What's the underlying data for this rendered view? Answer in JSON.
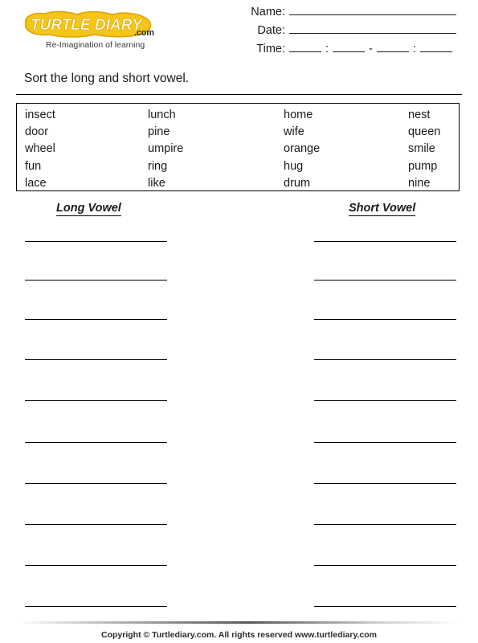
{
  "brand": {
    "logo_text": "Turtle Diary",
    "logo_word_1": "TURTLE",
    "logo_word_2": "DIARY",
    "dotcom": ".com",
    "tagline": "Re-Imagination of learning",
    "logo_fill": "#f5c518",
    "logo_stroke": "#e8a000",
    "logo_text_color": "#ffffff"
  },
  "header": {
    "name_label": "Name:",
    "date_label": "Date:",
    "time_label": "Time:",
    "name_value": "",
    "date_value": "",
    "time_sep_1": ":",
    "time_sep_2": "-",
    "time_sep_3": ":"
  },
  "instruction": {
    "text": "Sort the long and short vowel."
  },
  "word_bank": {
    "rows": [
      [
        "insect",
        "lunch",
        "home",
        "nest"
      ],
      [
        "door",
        "pine",
        "wife",
        "queen"
      ],
      [
        "wheel",
        "umpire",
        "orange",
        "smile"
      ],
      [
        "fun",
        "ring",
        "hug",
        "pump"
      ],
      [
        "lace",
        "like",
        "drum",
        "nine"
      ]
    ],
    "words_flat": [
      "insect",
      "lunch",
      "home",
      "nest",
      "door",
      "pine",
      "wife",
      "queen",
      "wheel",
      "umpire",
      "orange",
      "smile",
      "fun",
      "ring",
      "hug",
      "pump",
      "lace",
      "like",
      "drum",
      "nine"
    ]
  },
  "answers": {
    "long_vowel_heading": "Long Vowel",
    "short_vowel_heading": "Short Vowel",
    "line_count_per_column": 10,
    "long_vowel_entries": [
      "",
      "",
      "",
      "",
      "",
      "",
      "",
      "",
      "",
      ""
    ],
    "short_vowel_entries": [
      "",
      "",
      "",
      "",
      "",
      "",
      "",
      "",
      "",
      ""
    ]
  },
  "footer": {
    "text": "Copyright © Turtlediary.com. All rights reserved  www.turtlediary.com"
  }
}
